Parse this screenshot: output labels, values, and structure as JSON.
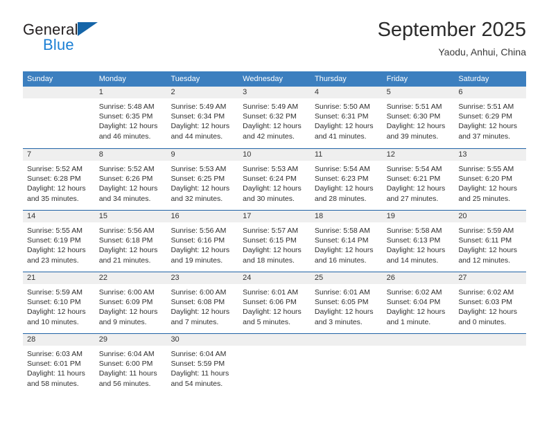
{
  "brand": {
    "name_part1": "General",
    "name_part2": "Blue",
    "triangle_icon": "triangle-icon",
    "colors": {
      "dark": "#231f20",
      "blue": "#1b7fd4",
      "triangle": "#1565a8"
    }
  },
  "header": {
    "title": "September 2025",
    "subtitle": "Yaodu, Anhui, China"
  },
  "theme": {
    "header_band": "#3c7fbf",
    "row_separator": "#1f62a5",
    "date_band": "#efefef",
    "text": "#2e2e2e"
  },
  "weekdays": [
    "Sunday",
    "Monday",
    "Tuesday",
    "Wednesday",
    "Thursday",
    "Friday",
    "Saturday"
  ],
  "weeks": [
    [
      {
        "date": "",
        "empty": true,
        "lines": []
      },
      {
        "date": "1",
        "empty": false,
        "lines": [
          "Sunrise: 5:48 AM",
          "Sunset: 6:35 PM",
          "Daylight: 12 hours",
          "and 46 minutes."
        ]
      },
      {
        "date": "2",
        "empty": false,
        "lines": [
          "Sunrise: 5:49 AM",
          "Sunset: 6:34 PM",
          "Daylight: 12 hours",
          "and 44 minutes."
        ]
      },
      {
        "date": "3",
        "empty": false,
        "lines": [
          "Sunrise: 5:49 AM",
          "Sunset: 6:32 PM",
          "Daylight: 12 hours",
          "and 42 minutes."
        ]
      },
      {
        "date": "4",
        "empty": false,
        "lines": [
          "Sunrise: 5:50 AM",
          "Sunset: 6:31 PM",
          "Daylight: 12 hours",
          "and 41 minutes."
        ]
      },
      {
        "date": "5",
        "empty": false,
        "lines": [
          "Sunrise: 5:51 AM",
          "Sunset: 6:30 PM",
          "Daylight: 12 hours",
          "and 39 minutes."
        ]
      },
      {
        "date": "6",
        "empty": false,
        "lines": [
          "Sunrise: 5:51 AM",
          "Sunset: 6:29 PM",
          "Daylight: 12 hours",
          "and 37 minutes."
        ]
      }
    ],
    [
      {
        "date": "7",
        "empty": false,
        "lines": [
          "Sunrise: 5:52 AM",
          "Sunset: 6:28 PM",
          "Daylight: 12 hours",
          "and 35 minutes."
        ]
      },
      {
        "date": "8",
        "empty": false,
        "lines": [
          "Sunrise: 5:52 AM",
          "Sunset: 6:26 PM",
          "Daylight: 12 hours",
          "and 34 minutes."
        ]
      },
      {
        "date": "9",
        "empty": false,
        "lines": [
          "Sunrise: 5:53 AM",
          "Sunset: 6:25 PM",
          "Daylight: 12 hours",
          "and 32 minutes."
        ]
      },
      {
        "date": "10",
        "empty": false,
        "lines": [
          "Sunrise: 5:53 AM",
          "Sunset: 6:24 PM",
          "Daylight: 12 hours",
          "and 30 minutes."
        ]
      },
      {
        "date": "11",
        "empty": false,
        "lines": [
          "Sunrise: 5:54 AM",
          "Sunset: 6:23 PM",
          "Daylight: 12 hours",
          "and 28 minutes."
        ]
      },
      {
        "date": "12",
        "empty": false,
        "lines": [
          "Sunrise: 5:54 AM",
          "Sunset: 6:21 PM",
          "Daylight: 12 hours",
          "and 27 minutes."
        ]
      },
      {
        "date": "13",
        "empty": false,
        "lines": [
          "Sunrise: 5:55 AM",
          "Sunset: 6:20 PM",
          "Daylight: 12 hours",
          "and 25 minutes."
        ]
      }
    ],
    [
      {
        "date": "14",
        "empty": false,
        "lines": [
          "Sunrise: 5:55 AM",
          "Sunset: 6:19 PM",
          "Daylight: 12 hours",
          "and 23 minutes."
        ]
      },
      {
        "date": "15",
        "empty": false,
        "lines": [
          "Sunrise: 5:56 AM",
          "Sunset: 6:18 PM",
          "Daylight: 12 hours",
          "and 21 minutes."
        ]
      },
      {
        "date": "16",
        "empty": false,
        "lines": [
          "Sunrise: 5:56 AM",
          "Sunset: 6:16 PM",
          "Daylight: 12 hours",
          "and 19 minutes."
        ]
      },
      {
        "date": "17",
        "empty": false,
        "lines": [
          "Sunrise: 5:57 AM",
          "Sunset: 6:15 PM",
          "Daylight: 12 hours",
          "and 18 minutes."
        ]
      },
      {
        "date": "18",
        "empty": false,
        "lines": [
          "Sunrise: 5:58 AM",
          "Sunset: 6:14 PM",
          "Daylight: 12 hours",
          "and 16 minutes."
        ]
      },
      {
        "date": "19",
        "empty": false,
        "lines": [
          "Sunrise: 5:58 AM",
          "Sunset: 6:13 PM",
          "Daylight: 12 hours",
          "and 14 minutes."
        ]
      },
      {
        "date": "20",
        "empty": false,
        "lines": [
          "Sunrise: 5:59 AM",
          "Sunset: 6:11 PM",
          "Daylight: 12 hours",
          "and 12 minutes."
        ]
      }
    ],
    [
      {
        "date": "21",
        "empty": false,
        "lines": [
          "Sunrise: 5:59 AM",
          "Sunset: 6:10 PM",
          "Daylight: 12 hours",
          "and 10 minutes."
        ]
      },
      {
        "date": "22",
        "empty": false,
        "lines": [
          "Sunrise: 6:00 AM",
          "Sunset: 6:09 PM",
          "Daylight: 12 hours",
          "and 9 minutes."
        ]
      },
      {
        "date": "23",
        "empty": false,
        "lines": [
          "Sunrise: 6:00 AM",
          "Sunset: 6:08 PM",
          "Daylight: 12 hours",
          "and 7 minutes."
        ]
      },
      {
        "date": "24",
        "empty": false,
        "lines": [
          "Sunrise: 6:01 AM",
          "Sunset: 6:06 PM",
          "Daylight: 12 hours",
          "and 5 minutes."
        ]
      },
      {
        "date": "25",
        "empty": false,
        "lines": [
          "Sunrise: 6:01 AM",
          "Sunset: 6:05 PM",
          "Daylight: 12 hours",
          "and 3 minutes."
        ]
      },
      {
        "date": "26",
        "empty": false,
        "lines": [
          "Sunrise: 6:02 AM",
          "Sunset: 6:04 PM",
          "Daylight: 12 hours",
          "and 1 minute."
        ]
      },
      {
        "date": "27",
        "empty": false,
        "lines": [
          "Sunrise: 6:02 AM",
          "Sunset: 6:03 PM",
          "Daylight: 12 hours",
          "and 0 minutes."
        ]
      }
    ],
    [
      {
        "date": "28",
        "empty": false,
        "lines": [
          "Sunrise: 6:03 AM",
          "Sunset: 6:01 PM",
          "Daylight: 11 hours",
          "and 58 minutes."
        ]
      },
      {
        "date": "29",
        "empty": false,
        "lines": [
          "Sunrise: 6:04 AM",
          "Sunset: 6:00 PM",
          "Daylight: 11 hours",
          "and 56 minutes."
        ]
      },
      {
        "date": "30",
        "empty": false,
        "lines": [
          "Sunrise: 6:04 AM",
          "Sunset: 5:59 PM",
          "Daylight: 11 hours",
          "and 54 minutes."
        ]
      },
      {
        "date": "",
        "empty": true,
        "lines": []
      },
      {
        "date": "",
        "empty": true,
        "lines": []
      },
      {
        "date": "",
        "empty": true,
        "lines": []
      },
      {
        "date": "",
        "empty": true,
        "lines": []
      }
    ]
  ]
}
